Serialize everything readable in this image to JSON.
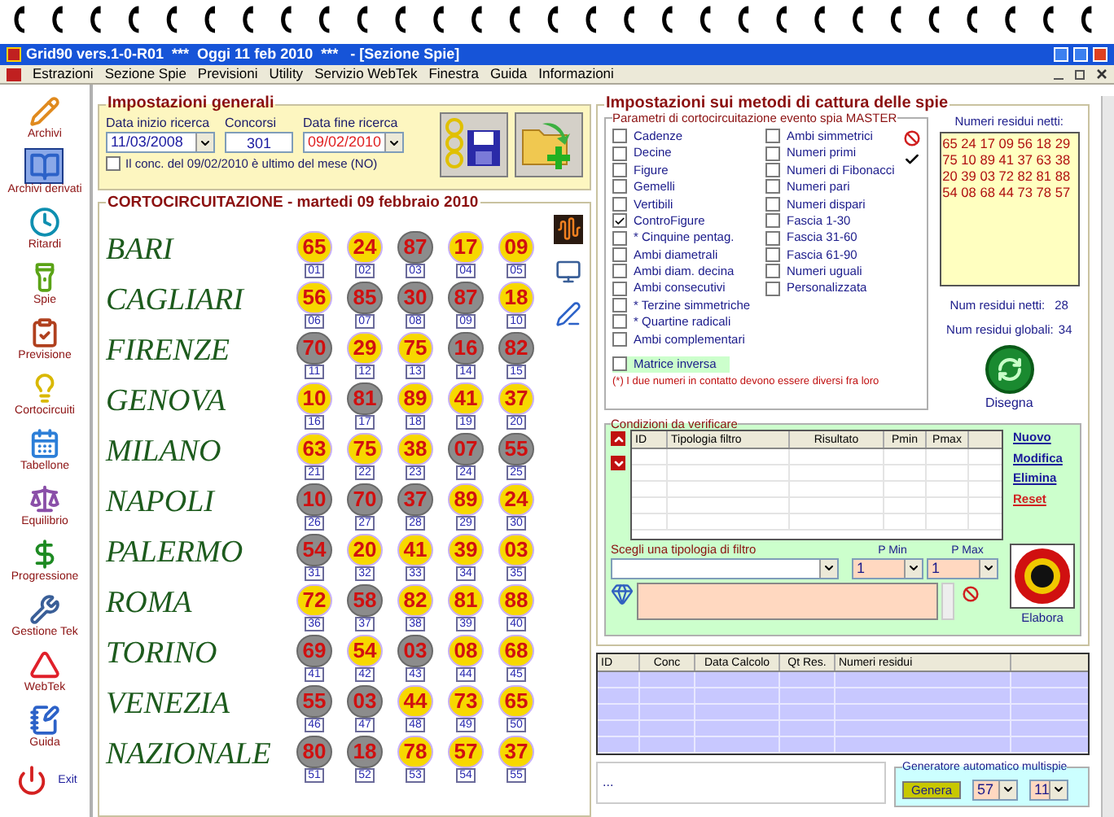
{
  "window": {
    "title": "Grid90 vers.1-0-R01  ***  Oggi 11 feb 2010  ***   - [Sezione Spie]"
  },
  "menu": [
    "Estrazioni",
    "Sezione Spie",
    "Previsioni",
    "Utility",
    "Servizio WebTek",
    "Finestra",
    "Guida",
    "Informazioni"
  ],
  "sidebar": [
    {
      "label": "Archivi",
      "selected": false
    },
    {
      "label": "Archivi derivati",
      "selected": true
    },
    {
      "label": "Ritardi",
      "selected": false
    },
    {
      "label": "Spie",
      "selected": false
    },
    {
      "label": "Previsione",
      "selected": false
    },
    {
      "label": "Cortocircuiti",
      "selected": false
    },
    {
      "label": "Tabellone",
      "selected": false
    },
    {
      "label": "Equilibrio",
      "selected": false
    },
    {
      "label": "Progressione",
      "selected": false
    },
    {
      "label": "Gestione Tek",
      "selected": false
    },
    {
      "label": "WebTek",
      "selected": false
    },
    {
      "label": "Guida",
      "selected": false
    },
    {
      "label": "Exit",
      "selected": false
    }
  ],
  "general": {
    "title": "Impostazioni generali",
    "start_label": "Data inizio ricerca",
    "start_value": "11/03/2008",
    "count_label": "Concorsi",
    "count_value": "301",
    "end_label": "Data fine ricerca",
    "end_value": "09/02/2010",
    "last_of_month": {
      "label": "Il conc. del 09/02/2010 è ultimo del mese (NO)",
      "checked": false
    }
  },
  "shortcircuit": {
    "title": "CORTOCIRCUITAZIONE - martedi 09 febbraio 2010",
    "rows": [
      {
        "city": "BARI",
        "balls": [
          {
            "n": "65",
            "i": "01",
            "lit": true
          },
          {
            "n": "24",
            "i": "02",
            "lit": true
          },
          {
            "n": "87",
            "i": "03",
            "lit": false
          },
          {
            "n": "17",
            "i": "04",
            "lit": true
          },
          {
            "n": "09",
            "i": "05",
            "lit": true
          }
        ]
      },
      {
        "city": "CAGLIARI",
        "balls": [
          {
            "n": "56",
            "i": "06",
            "lit": true
          },
          {
            "n": "85",
            "i": "07",
            "lit": false
          },
          {
            "n": "30",
            "i": "08",
            "lit": false
          },
          {
            "n": "87",
            "i": "09",
            "lit": false
          },
          {
            "n": "18",
            "i": "10",
            "lit": true
          }
        ]
      },
      {
        "city": "FIRENZE",
        "balls": [
          {
            "n": "70",
            "i": "11",
            "lit": false
          },
          {
            "n": "29",
            "i": "12",
            "lit": true
          },
          {
            "n": "75",
            "i": "13",
            "lit": true
          },
          {
            "n": "16",
            "i": "14",
            "lit": false
          },
          {
            "n": "82",
            "i": "15",
            "lit": false
          }
        ]
      },
      {
        "city": "GENOVA",
        "balls": [
          {
            "n": "10",
            "i": "16",
            "lit": true
          },
          {
            "n": "81",
            "i": "17",
            "lit": false
          },
          {
            "n": "89",
            "i": "18",
            "lit": true
          },
          {
            "n": "41",
            "i": "19",
            "lit": true
          },
          {
            "n": "37",
            "i": "20",
            "lit": true
          }
        ]
      },
      {
        "city": "MILANO",
        "balls": [
          {
            "n": "63",
            "i": "21",
            "lit": true
          },
          {
            "n": "75",
            "i": "22",
            "lit": true
          },
          {
            "n": "38",
            "i": "23",
            "lit": true
          },
          {
            "n": "07",
            "i": "24",
            "lit": false
          },
          {
            "n": "55",
            "i": "25",
            "lit": false
          }
        ]
      },
      {
        "city": "NAPOLI",
        "balls": [
          {
            "n": "10",
            "i": "26",
            "lit": false
          },
          {
            "n": "70",
            "i": "27",
            "lit": false
          },
          {
            "n": "37",
            "i": "28",
            "lit": false
          },
          {
            "n": "89",
            "i": "29",
            "lit": true
          },
          {
            "n": "24",
            "i": "30",
            "lit": true
          }
        ]
      },
      {
        "city": "PALERMO",
        "balls": [
          {
            "n": "54",
            "i": "31",
            "lit": false
          },
          {
            "n": "20",
            "i": "32",
            "lit": true
          },
          {
            "n": "41",
            "i": "33",
            "lit": true
          },
          {
            "n": "39",
            "i": "34",
            "lit": true
          },
          {
            "n": "03",
            "i": "35",
            "lit": true
          }
        ]
      },
      {
        "city": "ROMA",
        "balls": [
          {
            "n": "72",
            "i": "36",
            "lit": true
          },
          {
            "n": "58",
            "i": "37",
            "lit": false
          },
          {
            "n": "82",
            "i": "38",
            "lit": true
          },
          {
            "n": "81",
            "i": "39",
            "lit": true
          },
          {
            "n": "88",
            "i": "40",
            "lit": true
          }
        ]
      },
      {
        "city": "TORINO",
        "balls": [
          {
            "n": "69",
            "i": "41",
            "lit": false
          },
          {
            "n": "54",
            "i": "42",
            "lit": true
          },
          {
            "n": "03",
            "i": "43",
            "lit": false
          },
          {
            "n": "08",
            "i": "44",
            "lit": true
          },
          {
            "n": "68",
            "i": "45",
            "lit": true
          }
        ]
      },
      {
        "city": "VENEZIA",
        "balls": [
          {
            "n": "55",
            "i": "46",
            "lit": false
          },
          {
            "n": "03",
            "i": "47",
            "lit": false
          },
          {
            "n": "44",
            "i": "48",
            "lit": true
          },
          {
            "n": "73",
            "i": "49",
            "lit": true
          },
          {
            "n": "65",
            "i": "50",
            "lit": true
          }
        ]
      },
      {
        "city": "NAZIONALE",
        "balls": [
          {
            "n": "80",
            "i": "51",
            "lit": false
          },
          {
            "n": "18",
            "i": "52",
            "lit": false
          },
          {
            "n": "78",
            "i": "53",
            "lit": true
          },
          {
            "n": "57",
            "i": "54",
            "lit": true
          },
          {
            "n": "37",
            "i": "55",
            "lit": true
          }
        ]
      }
    ]
  },
  "methods": {
    "title": "Impostazioni sui metodi di cattura delle spie",
    "params_title": "Parametri di cortocircuitazione evento spia MASTER",
    "left_options": [
      {
        "label": "Cadenze",
        "checked": false
      },
      {
        "label": "Decine",
        "checked": false
      },
      {
        "label": "Figure",
        "checked": false
      },
      {
        "label": "Gemelli",
        "checked": false
      },
      {
        "label": "Vertibili",
        "checked": false
      },
      {
        "label": "ControFigure",
        "checked": true
      },
      {
        "label": "* Cinquine pentag.",
        "checked": false
      },
      {
        "label": "Ambi diametrali",
        "checked": false
      },
      {
        "label": "Ambi diam. decina",
        "checked": false
      },
      {
        "label": "Ambi consecutivi",
        "checked": false
      },
      {
        "label": "* Terzine simmetriche",
        "checked": false
      },
      {
        "label": "* Quartine radicali",
        "checked": false
      },
      {
        "label": "Ambi complementari",
        "checked": false
      }
    ],
    "right_options": [
      {
        "label": "Ambi simmetrici",
        "checked": false
      },
      {
        "label": "Numeri primi",
        "checked": false
      },
      {
        "label": "Numeri di Fibonacci",
        "checked": false
      },
      {
        "label": "Numeri pari",
        "checked": false
      },
      {
        "label": "Numeri dispari",
        "checked": false
      },
      {
        "label": "Fascia 1-30",
        "checked": false
      },
      {
        "label": "Fascia 31-60",
        "checked": false
      },
      {
        "label": "Fascia 61-90",
        "checked": false
      },
      {
        "label": "Numeri uguali",
        "checked": false
      },
      {
        "label": "Personalizzata",
        "checked": false
      }
    ],
    "inverse_matrix": {
      "label": "Matrice inversa",
      "checked": false
    },
    "footnote": "(*) I due numeri in contatto devono essere diversi fra loro",
    "residual_title": "Numeri residui netti:",
    "residual_lines": [
      "65 24 17 09 56 18 29",
      "75 10 89 41 37 63 38",
      "20 39 03 72 82 81 88",
      "54 08 68 44 73 78 57"
    ],
    "net_label": "Num residui netti:",
    "net_value": "28",
    "global_label": "Num residui globali:",
    "global_value": "34",
    "draw_label": "Disegna"
  },
  "conditions": {
    "title": "Condizioni da verificare",
    "columns": [
      "ID",
      "Tipologia filtro",
      "Risultato",
      "Pmin",
      "Pmax"
    ],
    "links": [
      {
        "label": "Nuovo",
        "kind": "normal"
      },
      {
        "label": "Modifica",
        "kind": "normal"
      },
      {
        "label": "Elimina",
        "kind": "normal"
      },
      {
        "label": "Reset",
        "kind": "danger"
      }
    ],
    "filter_label": "Scegli una tipologia di filtro",
    "pmin_label": "P Min",
    "pmax_label": "P Max",
    "pmin_value": "1",
    "pmax_value": "1",
    "run_label": "Elabora"
  },
  "results": {
    "columns": [
      "ID",
      "Conc",
      "Data Calcolo",
      "Qt Res.",
      "Numeri residui"
    ]
  },
  "status": {
    "text": "..."
  },
  "generator": {
    "title": "Generatore automatico multispie",
    "button": "Genera",
    "value_1": "57",
    "value_2": "11"
  }
}
